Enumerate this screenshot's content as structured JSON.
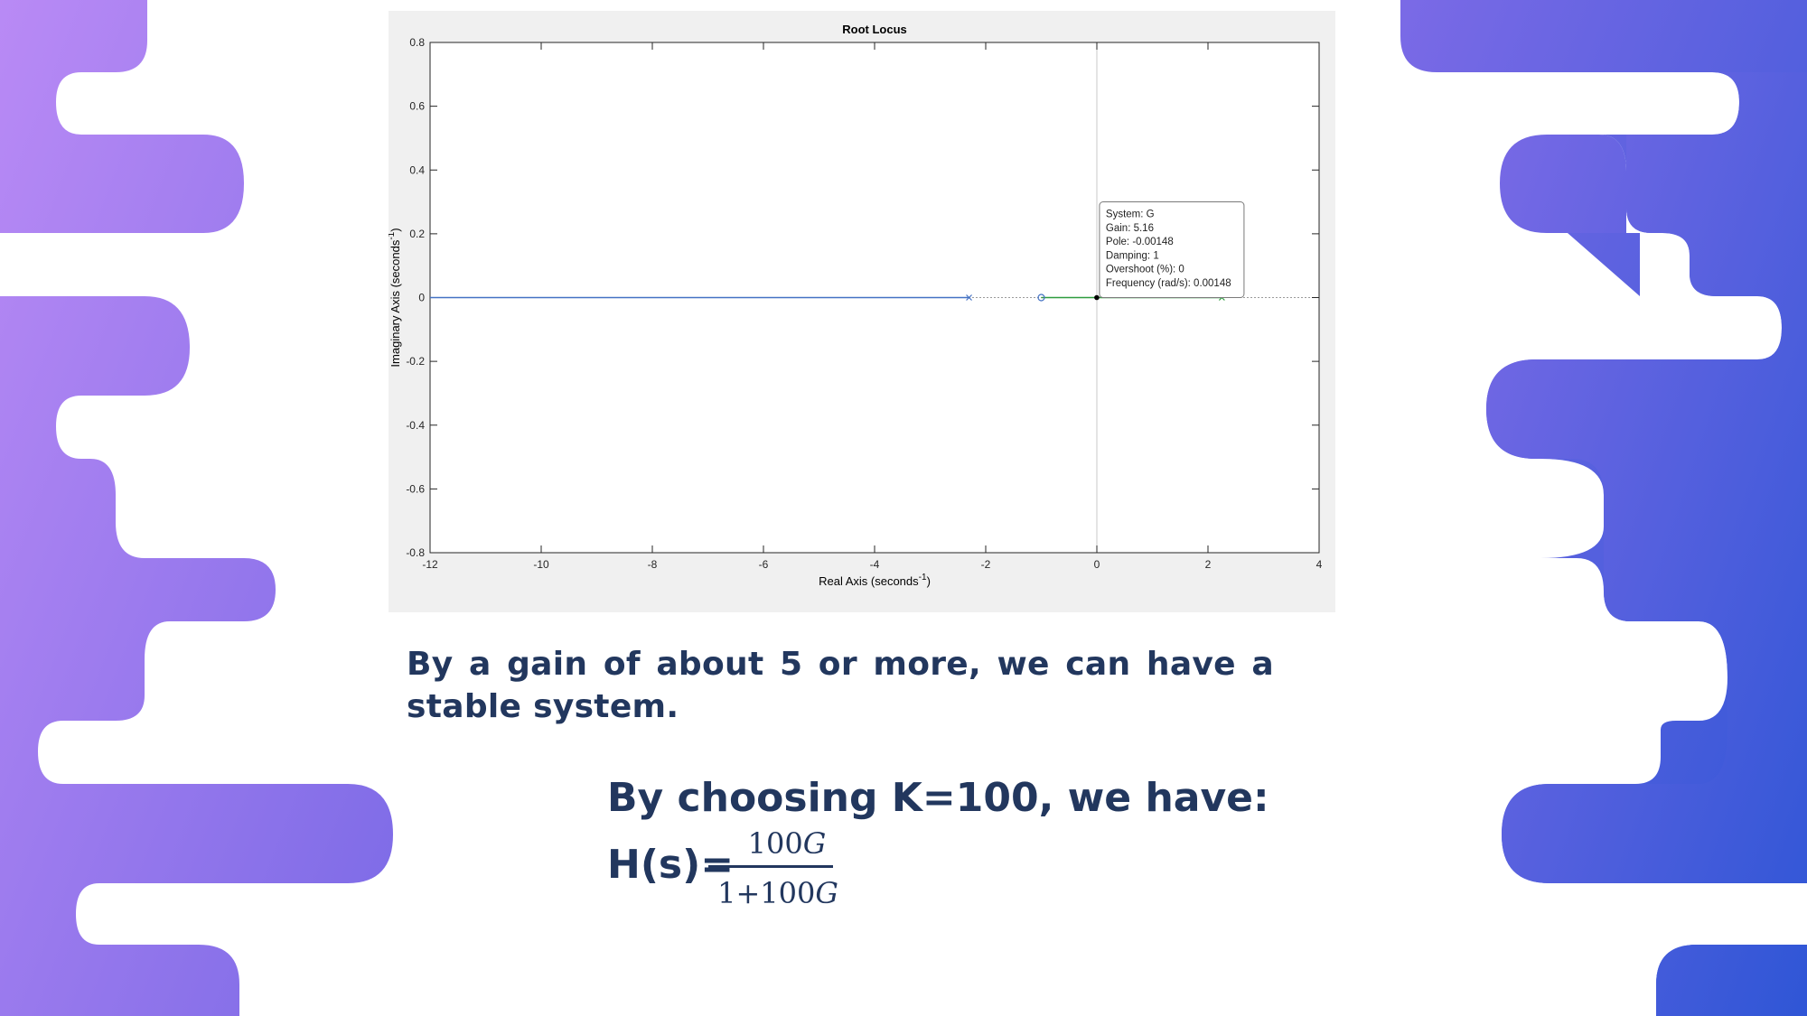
{
  "colors": {
    "gradient_start": "#b98af5",
    "gradient_mid": "#7b6ae6",
    "gradient_end": "#2f56d6",
    "text": "#22375e",
    "panel_bg": "#f0f0f0",
    "locus_line": "#4472c4",
    "locus_green": "#2e9c3e"
  },
  "chart_data": {
    "type": "scatter",
    "title": "Root Locus",
    "xlabel": "Real Axis (seconds",
    "xlabel_sup": "-1",
    "ylabel": "Imaginary Axis (seconds",
    "ylabel_sup": "-1",
    "xlim": [
      -12,
      4
    ],
    "ylim": [
      -0.8,
      0.8
    ],
    "xticks": [
      "-12",
      "-10",
      "-8",
      "-6",
      "-4",
      "-2",
      "0",
      "2",
      "4"
    ],
    "yticks": [
      "0.8",
      "0.6",
      "0.4",
      "0.2",
      "0",
      "-0.2",
      "-0.4",
      "-0.6",
      "-0.8"
    ],
    "grid": false,
    "series": [
      {
        "kind": "line",
        "x": [
          -12,
          -2.3
        ],
        "y": [
          0,
          0
        ]
      },
      {
        "kind": "line",
        "x": [
          -1,
          2.25
        ],
        "y": [
          0,
          0
        ]
      }
    ],
    "poles": [
      {
        "x": -2.3,
        "y": 0
      },
      {
        "x": 2.25,
        "y": 0
      }
    ],
    "zeros": [
      {
        "x": -1,
        "y": 0
      }
    ],
    "selected_point": {
      "x": -0.00148,
      "y": 0
    },
    "datatip": [
      "System: G",
      "Gain: 5.16",
      "Pole: -0.00148",
      "Damping: 1",
      "Overshoot (%): 0",
      "Frequency (rad/s): 0.00148"
    ]
  },
  "text": {
    "stable_note": "By a gain of about 5 or more, we can have a stable system.",
    "choose_k": "By choosing K=100, we have:",
    "formula_lhs": "H(s)=",
    "formula_num": "100𝐺",
    "formula_den": "1+100𝐺"
  }
}
